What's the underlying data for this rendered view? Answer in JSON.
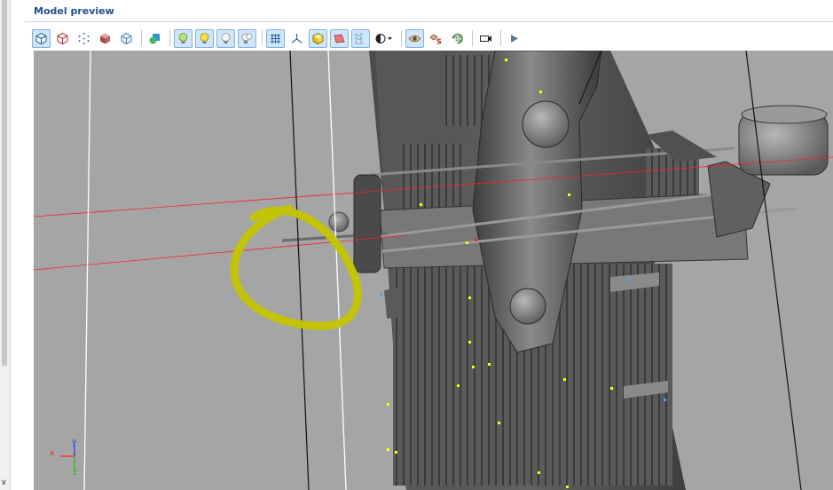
{
  "panel": {
    "title": "Model preview"
  },
  "toolbar": {
    "buttons": [
      {
        "id": "view-perspective",
        "icon": "cube-outline-icon",
        "active": true
      },
      {
        "id": "view-wire",
        "icon": "cube-wire-red-icon",
        "active": false
      },
      {
        "id": "view-points",
        "icon": "points-icon",
        "active": false
      },
      {
        "id": "view-solid",
        "icon": "cube-solid-red-icon",
        "active": false
      },
      {
        "id": "view-box",
        "icon": "cube-blue-icon",
        "active": false
      },
      {
        "id": "shapes",
        "icon": "shapes-icon",
        "active": false
      },
      {
        "id": "light-1",
        "icon": "bulb-green-icon",
        "active": true
      },
      {
        "id": "light-2",
        "icon": "bulb-yellow-icon",
        "active": true
      },
      {
        "id": "light-3",
        "icon": "bulb-white-icon",
        "active": true
      },
      {
        "id": "light-4",
        "icon": "bulb-double-icon",
        "active": true
      },
      {
        "id": "grid",
        "icon": "grid-icon",
        "active": true
      },
      {
        "id": "axes",
        "icon": "axes-icon",
        "active": false
      },
      {
        "id": "bounding-box",
        "icon": "cube-yellow-icon",
        "active": true
      },
      {
        "id": "plane",
        "icon": "plane-red-icon",
        "active": true
      },
      {
        "id": "matrix",
        "icon": "matrix-icon",
        "active": true
      },
      {
        "id": "shading",
        "icon": "shading-dropdown-icon",
        "active": false
      },
      {
        "id": "eye",
        "icon": "eye-icon",
        "active": true
      },
      {
        "id": "skin",
        "icon": "skin-icon",
        "active": false
      },
      {
        "id": "rotate",
        "icon": "rotate-icon",
        "active": false
      },
      {
        "id": "camera",
        "icon": "camera-icon",
        "active": false
      },
      {
        "id": "play",
        "icon": "play-icon",
        "active": false
      }
    ]
  },
  "viewport": {
    "axes": {
      "x_label": "x",
      "y_label": "y",
      "z_label": "z"
    },
    "colors": {
      "background": "#a5a5a5",
      "highlight": "#c4c400",
      "axis_line": "#ff2020",
      "vertex_marker": "#ffff00",
      "vertex_marker_blue": "#4aa3ff"
    }
  }
}
